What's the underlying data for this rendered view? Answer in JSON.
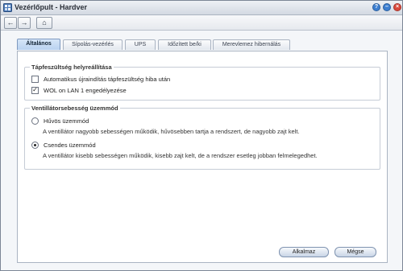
{
  "window": {
    "title": "Vezérlőpult - Hardver",
    "help_icon": "?",
    "minimize_icon": "–",
    "close_icon": "×"
  },
  "toolbar": {
    "back_icon": "←",
    "forward_icon": "→",
    "home_icon": "⌂"
  },
  "tabs": [
    {
      "label": "Általános",
      "active": true
    },
    {
      "label": "Sípolás-vezérlés",
      "active": false
    },
    {
      "label": "UPS",
      "active": false
    },
    {
      "label": "Időzített be/ki",
      "active": false
    },
    {
      "label": "Merevlemez hibernálás",
      "active": false
    }
  ],
  "power_recovery": {
    "legend": "Tápfeszültség helyreállítása",
    "options": [
      {
        "label": "Automatikus újraindítás tápfeszültség hiba után",
        "checked": false
      },
      {
        "label": "WOL on LAN 1 engedélyezése",
        "checked": true
      }
    ]
  },
  "fan_mode": {
    "legend": "Ventillátorsebesség üzemmód",
    "options": [
      {
        "label": "Hűvös üzemmód",
        "selected": false,
        "description": "A ventillátor nagyobb sebességen működik, hűvösebben tartja a rendszert, de nagyobb zajt kelt."
      },
      {
        "label": "Csendes üzemmód",
        "selected": true,
        "description": "A ventillátor kisebb sebességen működik, kisebb zajt kelt, de a rendszer esetleg jobban felmelegedhet."
      }
    ]
  },
  "buttons": {
    "apply": "Alkalmaz",
    "reset": "Mégse"
  },
  "colors": {
    "accent": "#b9d2f0",
    "help": "#3d7fd1",
    "minimize": "#3d7fd1",
    "close": "#d9483b"
  }
}
